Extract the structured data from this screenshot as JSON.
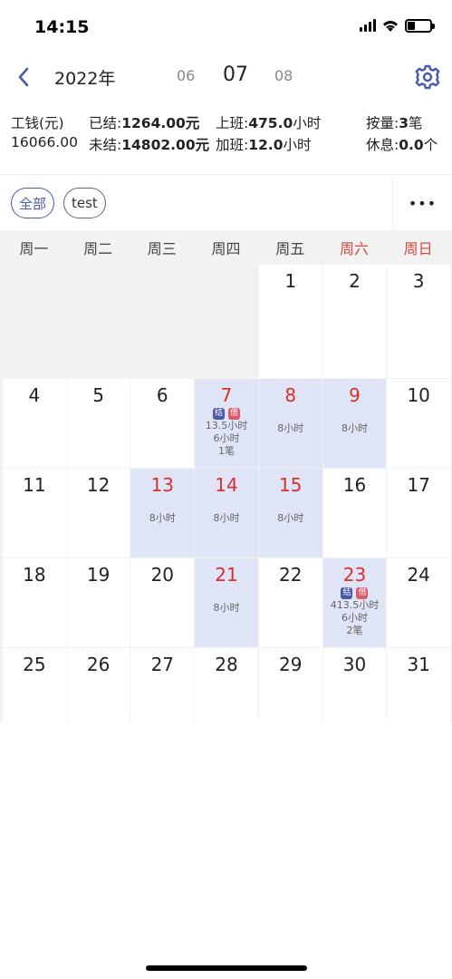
{
  "status": {
    "time": "14:15",
    "battery_level": 0.35
  },
  "nav": {
    "year": "2022年",
    "prev_month": "06",
    "current_month": "07",
    "next_month": "08"
  },
  "summary": {
    "wage_label": "工钱(元)",
    "wage_value": "16066.00",
    "settled_label": "已结:",
    "settled_value": "1264.00元",
    "unsettled_label": "未结:",
    "unsettled_value": "14802.00元",
    "work_label": "上班:",
    "work_value": "475.0",
    "work_unit": "小时",
    "overtime_label": "加班:",
    "overtime_value": "12.0",
    "overtime_unit": "小时",
    "piece_label": "按量:",
    "piece_value": "3",
    "piece_unit": "笔",
    "rest_label": "休息:",
    "rest_value": "0.0",
    "rest_unit": "个"
  },
  "filters": {
    "all_label": "全部",
    "test_label": "test",
    "more_label": "•••"
  },
  "calendar": {
    "weekdays": [
      "周一",
      "周二",
      "周三",
      "周四",
      "周五",
      "周六",
      "周日"
    ],
    "weeks": [
      [
        {
          "day": ""
        },
        {
          "day": ""
        },
        {
          "day": ""
        },
        {
          "day": ""
        },
        {
          "day": "1"
        },
        {
          "day": "2"
        },
        {
          "day": "3"
        }
      ],
      [
        {
          "day": "4"
        },
        {
          "day": "5"
        },
        {
          "day": "6"
        },
        {
          "day": "7",
          "work": true,
          "settled_badge": "结",
          "loan_badge": "借",
          "lines": [
            "13.5小时",
            "6小时",
            "1笔"
          ]
        },
        {
          "day": "8",
          "work": true,
          "lines": [
            "8小时"
          ]
        },
        {
          "day": "9",
          "work": true,
          "lines": [
            "8小时"
          ]
        },
        {
          "day": "10"
        }
      ],
      [
        {
          "day": "11"
        },
        {
          "day": "12"
        },
        {
          "day": "13",
          "work": true,
          "lines": [
            "8小时"
          ]
        },
        {
          "day": "14",
          "work": true,
          "lines": [
            "8小时"
          ]
        },
        {
          "day": "15",
          "work": true,
          "lines": [
            "8小时"
          ]
        },
        {
          "day": "16"
        },
        {
          "day": "17"
        }
      ],
      [
        {
          "day": "18"
        },
        {
          "day": "19"
        },
        {
          "day": "20"
        },
        {
          "day": "21",
          "work": true,
          "lines": [
            "8小时"
          ]
        },
        {
          "day": "22"
        },
        {
          "day": "23",
          "work": true,
          "settled_badge": "结",
          "loan_badge": "借",
          "lines": [
            "413.5小时",
            "6小时",
            "2笔"
          ]
        },
        {
          "day": "24"
        }
      ],
      [
        {
          "day": "25"
        },
        {
          "day": "26"
        },
        {
          "day": "27"
        },
        {
          "day": "28"
        },
        {
          "day": "29"
        },
        {
          "day": "30"
        },
        {
          "day": "31"
        }
      ]
    ]
  }
}
